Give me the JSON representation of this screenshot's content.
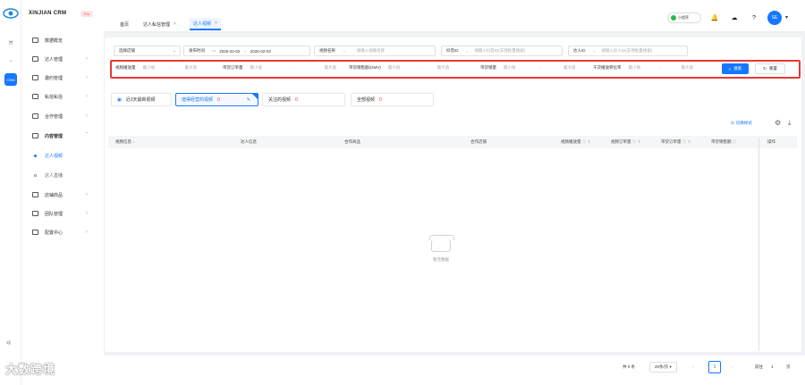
{
  "rail": {
    "items": [
      "icon-1",
      "icon-2",
      "CRM"
    ]
  },
  "sidebar": {
    "brand": "XINJIAN CRM",
    "badge": "Pro",
    "items": [
      {
        "label": "数据概览"
      },
      {
        "label": "达人管理"
      },
      {
        "label": "邀约管理"
      },
      {
        "label": "私信私信"
      },
      {
        "label": "合作管理"
      },
      {
        "label": "内容管理"
      },
      {
        "label": "达人视频"
      },
      {
        "label": "达人直播"
      },
      {
        "label": "店铺商品"
      },
      {
        "label": "团队管理"
      },
      {
        "label": "配置中心"
      }
    ]
  },
  "header": {
    "tabs": [
      {
        "label": "首页"
      },
      {
        "label": "达人私信管理"
      },
      {
        "label": "达人视频"
      }
    ],
    "mini_program": "小程序",
    "avatar": "SE"
  },
  "filters": {
    "store_placeholder": "选择店铺",
    "publish_label": "发布时间",
    "date_start": "2026-02-02",
    "date_sep": "-",
    "date_end": "2026-02-02",
    "video_name_label": "视频名称",
    "video_name_placeholder": "请输入视频名称",
    "douyin_id_label": "抖音ID",
    "douyin_id_placeholder": "请输入抖音ID(支持批量搜索)",
    "expert_id_label": "达人ID",
    "expert_id_placeholder": "请输入达人ID(支持批量搜索)",
    "ranges": [
      {
        "label": "视频播放量",
        "min": "最小值",
        "max": "最大值"
      },
      {
        "label": "带货订单量",
        "min": "最小值",
        "max": "最大值"
      },
      {
        "label": "带货销售额(GMV)",
        "min": "最小值",
        "max": "最大值"
      },
      {
        "label": "带货销量",
        "min": "最小值",
        "max": "最大值"
      },
      {
        "label": "千次播放转化率",
        "min": "最小值",
        "max": "最大值"
      }
    ],
    "search_btn": "搜索",
    "reset_btn": "重置"
  },
  "video_tabs": [
    {
      "label": "近3天最新视频",
      "count": ""
    },
    {
      "label": "值得经营的视频",
      "count": "0"
    },
    {
      "label": "关注的视频",
      "count": "0"
    },
    {
      "label": "全部视频",
      "count": "0"
    }
  ],
  "table": {
    "switch_label": "切换样式",
    "columns": [
      "视频信息",
      "达人信息",
      "合作商品",
      "合作店铺",
      "视频播放量",
      "视频订单量",
      "带货订单量",
      "带货销售额",
      "操作"
    ],
    "empty": "暂无数据"
  },
  "pagination": {
    "total": "共 0 条",
    "page_size": "20条/页",
    "current": "1",
    "goto_label": "前往",
    "goto_value": "1",
    "unit": "页"
  },
  "watermark": "大数跨境"
}
